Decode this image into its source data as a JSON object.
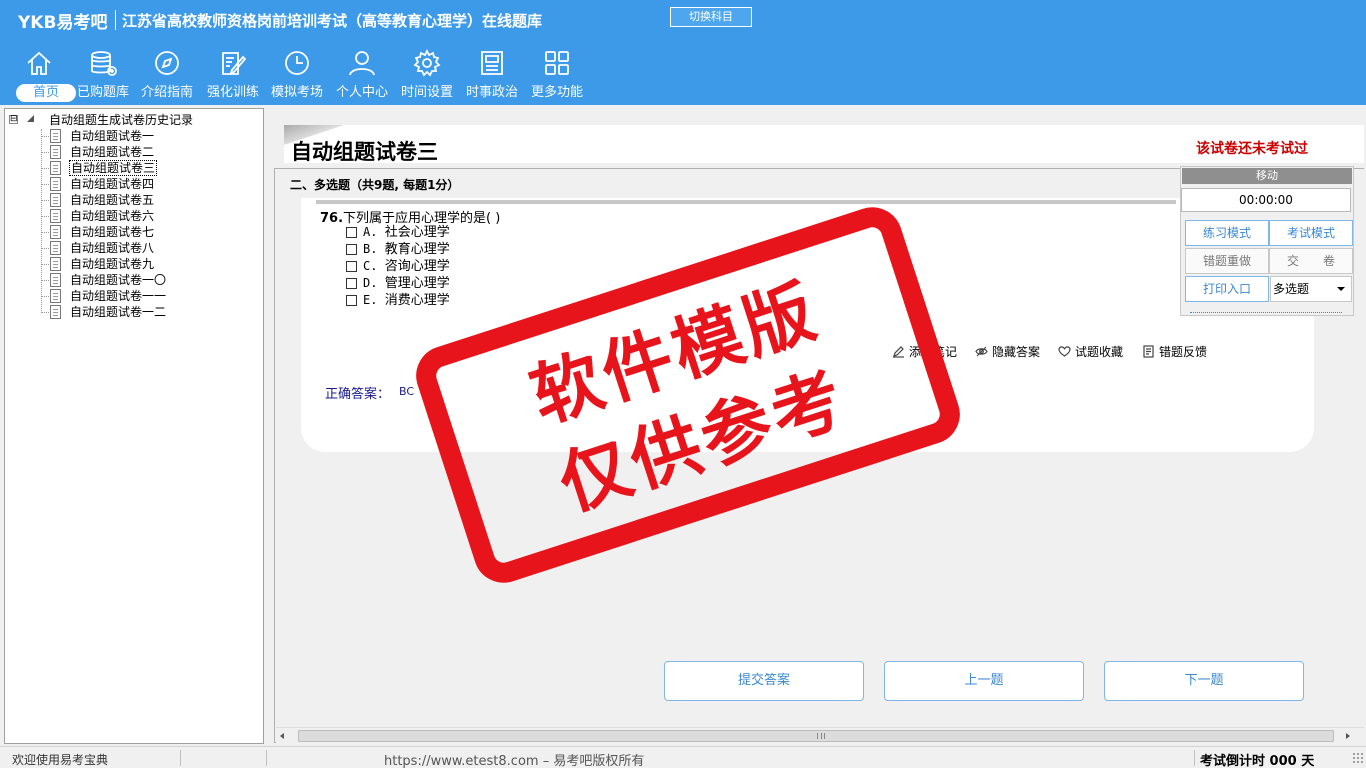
{
  "header": {
    "logo": "YKB易考吧",
    "title": "江苏省高校教师资格岗前培训考试（高等教育心理学）在线题库",
    "switch_label": "切换科目"
  },
  "nav": [
    {
      "label": "首页",
      "icon": "home-icon"
    },
    {
      "label": "已购题库",
      "icon": "database-icon"
    },
    {
      "label": "介绍指南",
      "icon": "compass-icon"
    },
    {
      "label": "强化训练",
      "icon": "edit-icon"
    },
    {
      "label": "模拟考场",
      "icon": "clock-icon"
    },
    {
      "label": "个人中心",
      "icon": "user-icon"
    },
    {
      "label": "时间设置",
      "icon": "gear-icon"
    },
    {
      "label": "时事政治",
      "icon": "newspaper-icon"
    },
    {
      "label": "更多功能",
      "icon": "grid-icon"
    }
  ],
  "tree": {
    "root": "自动组题生成试卷历史记录",
    "toggle": "⊟",
    "items": [
      "自动组题试卷一",
      "自动组题试卷二",
      "自动组题试卷三",
      "自动组题试卷四",
      "自动组题试卷五",
      "自动组题试卷六",
      "自动组题试卷七",
      "自动组题试卷八",
      "自动组题试卷九",
      "自动组题试卷一〇",
      "自动组题试卷一一",
      "自动组题试卷一二"
    ],
    "selected_index": 2
  },
  "paper": {
    "title": "自动组题试卷三",
    "status": "该试卷还未考试过"
  },
  "section": {
    "title": "二、多选题（共9题, 每题1分）"
  },
  "question": {
    "number": "76.",
    "text": "下列属于应用心理学的是( )",
    "options": [
      {
        "key": "A.",
        "text": "社会心理学"
      },
      {
        "key": "B.",
        "text": "教育心理学"
      },
      {
        "key": "C.",
        "text": "咨询心理学"
      },
      {
        "key": "D.",
        "text": "管理心理学"
      },
      {
        "key": "E.",
        "text": "消费心理学"
      }
    ],
    "answer_label": "正确答案：",
    "answer_value": "BC"
  },
  "tools": [
    {
      "label": "添加笔记",
      "icon": "pencil-icon"
    },
    {
      "label": "隐藏答案",
      "icon": "eye-hide-icon"
    },
    {
      "label": "试题收藏",
      "icon": "heart-icon"
    },
    {
      "label": "错题反馈",
      "icon": "feedback-icon"
    }
  ],
  "control": {
    "move_label": "移动",
    "timer": "00:00:00",
    "practice_mode": "练习模式",
    "exam_mode": "考试模式",
    "redo_wrong": "错题重做",
    "submit_paper": "交　　卷",
    "print": "打印入口",
    "type_select": "多选题"
  },
  "buttons": {
    "submit": "提交答案",
    "prev": "上一题",
    "next": "下一题"
  },
  "status": {
    "welcome": "欢迎使用易考宝典",
    "copyright": "https://www.etest8.com – 易考吧版权所有",
    "countdown": "考试倒计时 000 天"
  },
  "watermark": {
    "line1": "软件模版",
    "line2": "仅供参考",
    "color": "#e8141b"
  },
  "colors": {
    "header_bg": "#3c9ae8",
    "accent": "#3b88d0",
    "status_red": "#cc0000"
  }
}
